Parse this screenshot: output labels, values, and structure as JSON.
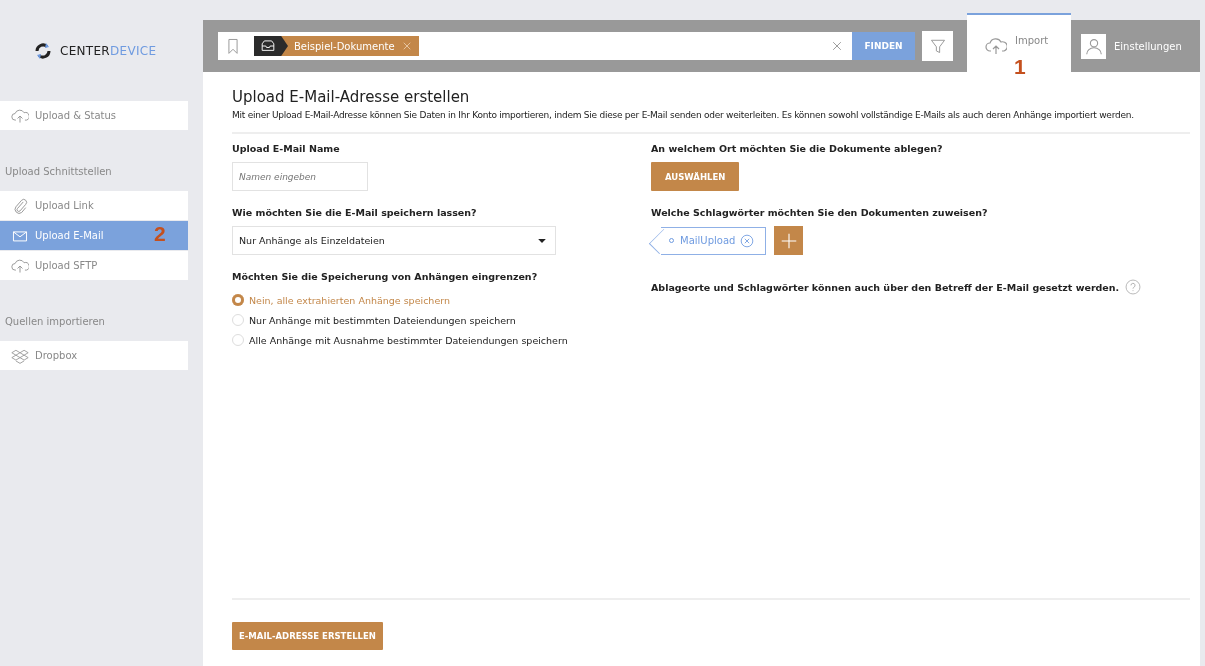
{
  "logo": {
    "part_1": "CENTER",
    "part_2": "DEVICE"
  },
  "sidebar": {
    "sections": [
      {
        "items": [
          {
            "label": "Upload & Status",
            "kind": "cloud",
            "selected": false
          }
        ]
      },
      {
        "title": "Upload Schnittstellen",
        "items": [
          {
            "label": "Upload Link",
            "kind": "clip",
            "selected": false
          },
          {
            "label": "Upload E-Mail",
            "kind": "mail",
            "selected": true,
            "callout": "2"
          },
          {
            "label": "Upload SFTP",
            "kind": "cloud",
            "selected": false
          }
        ]
      },
      {
        "title": "Quellen importieren",
        "items": [
          {
            "label": "Dropbox",
            "kind": "box",
            "selected": false
          }
        ]
      }
    ]
  },
  "search": {
    "chip": "Beispiel-Dokumente",
    "button": "FINDEN"
  },
  "tabs": [
    {
      "label": "Import",
      "kind": "cloud",
      "selected": true,
      "callout": "1"
    },
    {
      "label": "Einstellungen",
      "kind": "user",
      "selected": false
    }
  ],
  "page": {
    "title": "Upload E-Mail-Adresse erstellen",
    "description": "Mit einer Upload E-Mail-Adresse können Sie Daten in Ihr Konto importieren, indem Sie diese per E-Mail senden oder weiterleiten. Es können sowohl vollständige E-Mails als auch deren Anhänge importiert werden."
  },
  "left_column": {
    "name_label": "Upload E-Mail Name",
    "name_placeholder": "Namen eingeben",
    "save_label": "Wie möchten Sie die E-Mail speichern lassen?",
    "save_value": "Nur Anhänge als Einzeldateien",
    "limit_label": "Möchten Sie die Speicherung von Anhängen eingrenzen?",
    "options": [
      {
        "label": "Nein, alle extrahierten Anhänge speichern",
        "selected": true
      },
      {
        "label": "Nur Anhänge mit bestimmten Dateiendungen speichern",
        "selected": false
      },
      {
        "label": "Alle Anhänge mit Ausnahme bestimmter Dateiendungen speichern",
        "selected": false
      }
    ]
  },
  "right_column": {
    "location_label": "An welchem Ort möchten Sie die Dokumente ablegen?",
    "location_button": "AUSWÄHLEN",
    "tags_label": "Welche Schlagwörter möchten Sie den Dokumenten zuweisen?",
    "tags": [
      "MailUpload"
    ],
    "hint": "Ablageorte und Schlagwörter können auch über den Betreff der E-Mail gesetzt werden."
  },
  "submit_button": "E-MAIL-ADRESSE ERSTELLEN"
}
